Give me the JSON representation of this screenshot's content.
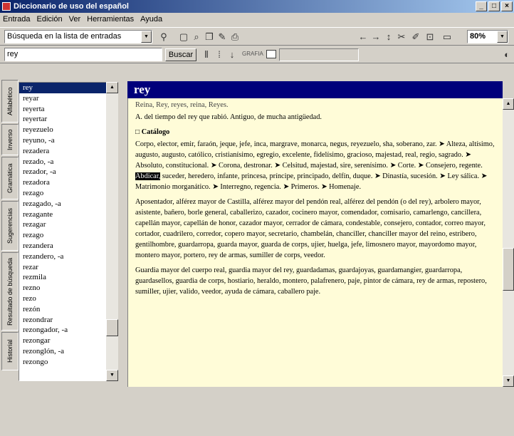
{
  "window": {
    "title": "Diccionario de uso del español"
  },
  "menu": [
    "Entrada",
    "Edición",
    "Ver",
    "Herramientas",
    "Ayuda"
  ],
  "toolbar": {
    "search_mode": "Búsqueda en la lista de entradas",
    "search_value": "rey",
    "search_button": "Buscar",
    "zoom": "80%",
    "status_label": "GRAFIA"
  },
  "tabs": [
    "Alfabético",
    "Inverso",
    "Gramática",
    "Sugerencias",
    "Resultado de búsqueda",
    "Historial"
  ],
  "wordlist": {
    "selected": "rey",
    "items": [
      "rey",
      "reyar",
      "reyerta",
      "reyertar",
      "reyezuelo",
      "reyuno, -a",
      "rezadera",
      "rezado, -a",
      "rezador, -a",
      "rezadora",
      "rezago",
      "rezagado, -a",
      "rezagante",
      "rezagar",
      "rezago",
      "rezandera",
      "rezandero, -a",
      "rezar",
      "rezmila",
      "rezno",
      "rezo",
      "rezón",
      "rezondrar",
      "rezongador, -a",
      "rezongar",
      "rezonglón, -a",
      "rezongo"
    ]
  },
  "entry": {
    "headword": "rey",
    "top_line": "Reina, Rey, reyes, reina, Reyes.",
    "sense": "A. del tiempo del rey que rabió. Antiguo, de mucha antigüedad.",
    "catalog_heading": "Catálogo",
    "catalog_text_1": "Corpo, elector, emir, faraón, jeque, jefe, inca, margrave, monarca, negus, reyezuelo, sha, soberano, zar. ➤ Alteza, altísimo, augusto, augusto, católico, cristianísimo, egregio, excelente, fidelísimo, gracioso, majestad, real, regio, sagrado. ➤ Absoluto, constitucional. ➤ Corona, destronar. ➤ Celsitud, majestad, sire, serenísimo. ➤ Corte. ➤ Consejero, regente.",
    "highlight": "Abdicar,",
    "catalog_text_2": "suceder, heredero, infante, princesa, príncipe, principado, delfín, duque. ➤ Dinastía, sucesión. ➤ Ley sálica. ➤ Matrimonio morganático. ➤ Interregno, regencia. ➤ Primeros. ➤ Homenaje.",
    "catalog_text_3": "Aposentador, alférez mayor de Castilla, alférez mayor del pendón real, alférez del pendón (o del rey), arbolero mayor, asistente, bañero, borle general, caballerizo, cazador, cocinero mayor, comendador, comisario, camarlengo, cancillera, capellán mayor, capellán de honor, cazador mayor, cerrador de cámara, condestable, consejero, contador, correo mayor, cortador, cuadrilero, corredor, copero mayor, secretario, chambelán, chanciller, chanciller mayor del reino, estribero, gentilhombre, guardarropa, guarda mayor, guarda de corps, ujier, huelga, jefe, limosnero mayor, mayordomo mayor, montero mayor, portero, rey de armas, sumiller de corps, veedor.",
    "catalog_text_4": "Guardia mayor del cuerpo real, guardia mayor del rey, guardadamas, guardajoyas, guardamangier, guardarropa, guardasellos, guardia de corps, hostiario, heraldo, montero, palafrenero, paje, pintor de cámara, rey de armas, repostero, sumiller, ujier, valido, veedor, ayuda de cámara, caballero paje."
  }
}
